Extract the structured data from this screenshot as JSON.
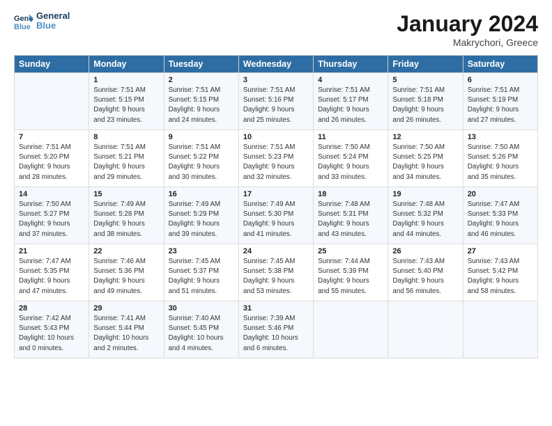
{
  "header": {
    "logo_line1": "General",
    "logo_line2": "Blue",
    "month": "January 2024",
    "location": "Makrychori, Greece"
  },
  "days_of_week": [
    "Sunday",
    "Monday",
    "Tuesday",
    "Wednesday",
    "Thursday",
    "Friday",
    "Saturday"
  ],
  "weeks": [
    [
      {
        "day": "",
        "info": ""
      },
      {
        "day": "1",
        "info": "Sunrise: 7:51 AM\nSunset: 5:15 PM\nDaylight: 9 hours\nand 23 minutes."
      },
      {
        "day": "2",
        "info": "Sunrise: 7:51 AM\nSunset: 5:15 PM\nDaylight: 9 hours\nand 24 minutes."
      },
      {
        "day": "3",
        "info": "Sunrise: 7:51 AM\nSunset: 5:16 PM\nDaylight: 9 hours\nand 25 minutes."
      },
      {
        "day": "4",
        "info": "Sunrise: 7:51 AM\nSunset: 5:17 PM\nDaylight: 9 hours\nand 26 minutes."
      },
      {
        "day": "5",
        "info": "Sunrise: 7:51 AM\nSunset: 5:18 PM\nDaylight: 9 hours\nand 26 minutes."
      },
      {
        "day": "6",
        "info": "Sunrise: 7:51 AM\nSunset: 5:19 PM\nDaylight: 9 hours\nand 27 minutes."
      }
    ],
    [
      {
        "day": "7",
        "info": "Sunrise: 7:51 AM\nSunset: 5:20 PM\nDaylight: 9 hours\nand 28 minutes."
      },
      {
        "day": "8",
        "info": "Sunrise: 7:51 AM\nSunset: 5:21 PM\nDaylight: 9 hours\nand 29 minutes."
      },
      {
        "day": "9",
        "info": "Sunrise: 7:51 AM\nSunset: 5:22 PM\nDaylight: 9 hours\nand 30 minutes."
      },
      {
        "day": "10",
        "info": "Sunrise: 7:51 AM\nSunset: 5:23 PM\nDaylight: 9 hours\nand 32 minutes."
      },
      {
        "day": "11",
        "info": "Sunrise: 7:50 AM\nSunset: 5:24 PM\nDaylight: 9 hours\nand 33 minutes."
      },
      {
        "day": "12",
        "info": "Sunrise: 7:50 AM\nSunset: 5:25 PM\nDaylight: 9 hours\nand 34 minutes."
      },
      {
        "day": "13",
        "info": "Sunrise: 7:50 AM\nSunset: 5:26 PM\nDaylight: 9 hours\nand 35 minutes."
      }
    ],
    [
      {
        "day": "14",
        "info": "Sunrise: 7:50 AM\nSunset: 5:27 PM\nDaylight: 9 hours\nand 37 minutes."
      },
      {
        "day": "15",
        "info": "Sunrise: 7:49 AM\nSunset: 5:28 PM\nDaylight: 9 hours\nand 38 minutes."
      },
      {
        "day": "16",
        "info": "Sunrise: 7:49 AM\nSunset: 5:29 PM\nDaylight: 9 hours\nand 39 minutes."
      },
      {
        "day": "17",
        "info": "Sunrise: 7:49 AM\nSunset: 5:30 PM\nDaylight: 9 hours\nand 41 minutes."
      },
      {
        "day": "18",
        "info": "Sunrise: 7:48 AM\nSunset: 5:31 PM\nDaylight: 9 hours\nand 43 minutes."
      },
      {
        "day": "19",
        "info": "Sunrise: 7:48 AM\nSunset: 5:32 PM\nDaylight: 9 hours\nand 44 minutes."
      },
      {
        "day": "20",
        "info": "Sunrise: 7:47 AM\nSunset: 5:33 PM\nDaylight: 9 hours\nand 46 minutes."
      }
    ],
    [
      {
        "day": "21",
        "info": "Sunrise: 7:47 AM\nSunset: 5:35 PM\nDaylight: 9 hours\nand 47 minutes."
      },
      {
        "day": "22",
        "info": "Sunrise: 7:46 AM\nSunset: 5:36 PM\nDaylight: 9 hours\nand 49 minutes."
      },
      {
        "day": "23",
        "info": "Sunrise: 7:45 AM\nSunset: 5:37 PM\nDaylight: 9 hours\nand 51 minutes."
      },
      {
        "day": "24",
        "info": "Sunrise: 7:45 AM\nSunset: 5:38 PM\nDaylight: 9 hours\nand 53 minutes."
      },
      {
        "day": "25",
        "info": "Sunrise: 7:44 AM\nSunset: 5:39 PM\nDaylight: 9 hours\nand 55 minutes."
      },
      {
        "day": "26",
        "info": "Sunrise: 7:43 AM\nSunset: 5:40 PM\nDaylight: 9 hours\nand 56 minutes."
      },
      {
        "day": "27",
        "info": "Sunrise: 7:43 AM\nSunset: 5:42 PM\nDaylight: 9 hours\nand 58 minutes."
      }
    ],
    [
      {
        "day": "28",
        "info": "Sunrise: 7:42 AM\nSunset: 5:43 PM\nDaylight: 10 hours\nand 0 minutes."
      },
      {
        "day": "29",
        "info": "Sunrise: 7:41 AM\nSunset: 5:44 PM\nDaylight: 10 hours\nand 2 minutes."
      },
      {
        "day": "30",
        "info": "Sunrise: 7:40 AM\nSunset: 5:45 PM\nDaylight: 10 hours\nand 4 minutes."
      },
      {
        "day": "31",
        "info": "Sunrise: 7:39 AM\nSunset: 5:46 PM\nDaylight: 10 hours\nand 6 minutes."
      },
      {
        "day": "",
        "info": ""
      },
      {
        "day": "",
        "info": ""
      },
      {
        "day": "",
        "info": ""
      }
    ]
  ]
}
